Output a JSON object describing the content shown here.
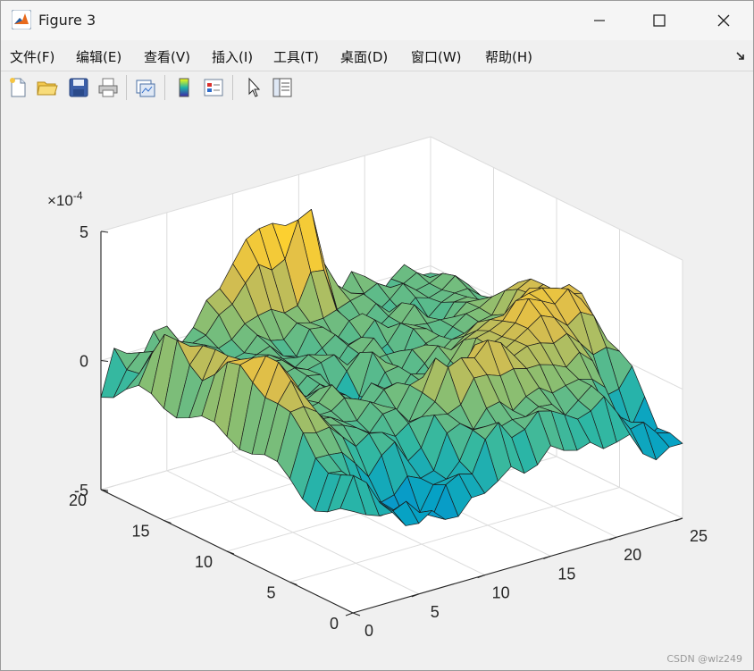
{
  "window": {
    "title": "Figure 3"
  },
  "menu": [
    "文件(F)",
    "编辑(E)",
    "查看(V)",
    "插入(I)",
    "工具(T)",
    "桌面(D)",
    "窗口(W)",
    "帮助(H)"
  ],
  "toolbar": [
    "new-figure",
    "open-file",
    "save",
    "print",
    "link-plot",
    "insert-colorbar",
    "insert-legend",
    "edit-plot",
    "property-inspector"
  ],
  "chart_data": {
    "type": "surface",
    "colormap": "parula",
    "exponent_label": "×10",
    "exponent_power": "-4",
    "x_ticks": [
      "0",
      "5",
      "10",
      "15",
      "20",
      "25"
    ],
    "y_ticks": [
      "0",
      "5",
      "10",
      "15",
      "20"
    ],
    "z_ticks": [
      "-5",
      "0",
      "5"
    ],
    "xlim": [
      0,
      25
    ],
    "ylim": [
      0,
      20
    ],
    "zlim": [
      -5,
      5
    ],
    "grid": true
  },
  "watermark": "CSDN @wlz249"
}
